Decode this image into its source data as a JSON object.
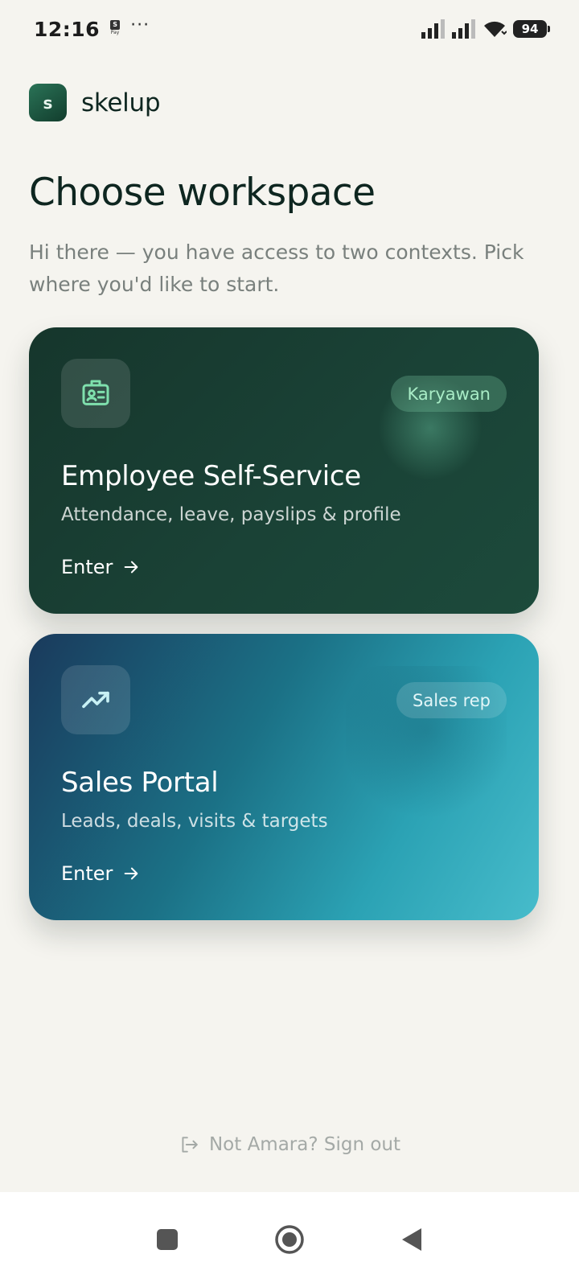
{
  "status_bar": {
    "time": "12:16",
    "pay_badge": "S",
    "pay_text": "Pay",
    "more": "···",
    "battery": "94"
  },
  "brand": {
    "logo_letter": "s",
    "name": "skelup"
  },
  "page": {
    "title": "Choose workspace",
    "subtitle": "Hi there — you have access to two contexts. Pick where you'd like to start."
  },
  "workspaces": [
    {
      "title": "Employee Self-Service",
      "description": "Attendance, leave, payslips & profile",
      "badge": "Karyawan",
      "enter_label": "Enter",
      "icon": "id-badge-icon",
      "accent": "#a8ecc6"
    },
    {
      "title": "Sales Portal",
      "description": "Leads, deals, visits & targets",
      "badge": "Sales rep",
      "enter_label": "Enter",
      "icon": "trending-up-icon",
      "accent": "#e3f6f8"
    }
  ],
  "footer": {
    "signout_label": "Not Amara? Sign out"
  },
  "colors": {
    "background": "#f5f4ef",
    "ess_card": "#1a4236",
    "sales_card_start": "#1a3a5c",
    "sales_card_end": "#47bccb"
  }
}
